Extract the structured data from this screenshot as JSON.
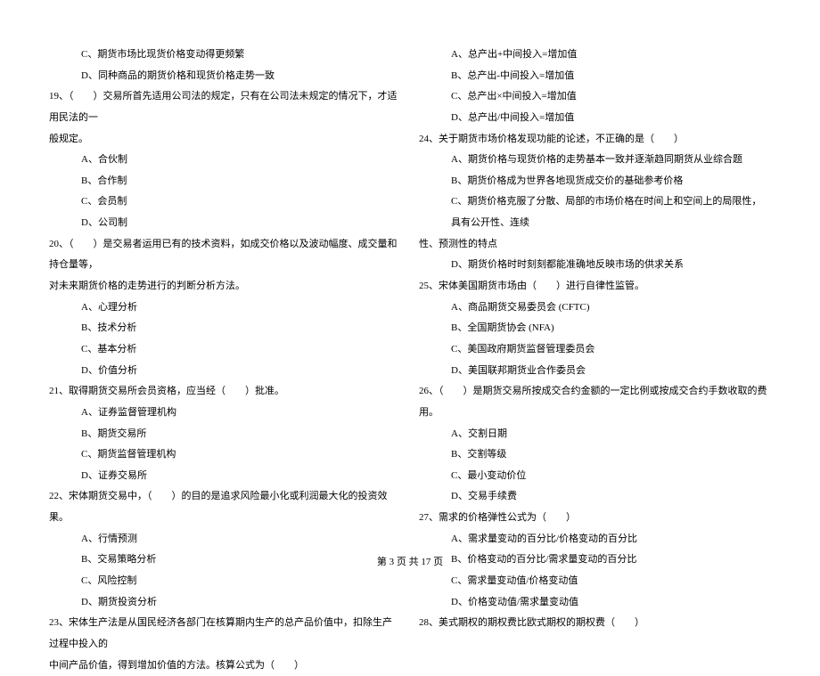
{
  "left_column": [
    {
      "type": "option",
      "text": "C、期货市场比现货价格变动得更频繁"
    },
    {
      "type": "option",
      "text": "D、同种商品的期货价格和现货价格走势一致"
    },
    {
      "type": "question",
      "text": "19、（　　）交易所首先适用公司法的规定，只有在公司法未规定的情况下，才适用民法的一"
    },
    {
      "type": "continuation",
      "text": "般规定。"
    },
    {
      "type": "option",
      "text": "A、合伙制"
    },
    {
      "type": "option",
      "text": "B、合作制"
    },
    {
      "type": "option",
      "text": "C、会员制"
    },
    {
      "type": "option",
      "text": "D、公司制"
    },
    {
      "type": "question",
      "text": "20、（　　）是交易者运用已有的技术资料，如成交价格以及波动幅度、成交量和持仓量等，"
    },
    {
      "type": "continuation",
      "text": "对未来期货价格的走势进行的判断分析方法。"
    },
    {
      "type": "option",
      "text": "A、心理分析"
    },
    {
      "type": "option",
      "text": "B、技术分析"
    },
    {
      "type": "option",
      "text": "C、基本分析"
    },
    {
      "type": "option",
      "text": "D、价值分析"
    },
    {
      "type": "question",
      "text": "21、取得期货交易所会员资格，应当经（　　）批准。"
    },
    {
      "type": "option",
      "text": "A、证券监督管理机构"
    },
    {
      "type": "option",
      "text": "B、期货交易所"
    },
    {
      "type": "option",
      "text": "C、期货监督管理机构"
    },
    {
      "type": "option",
      "text": "D、证券交易所"
    },
    {
      "type": "question",
      "text": "22、宋体期货交易中，（　　）的目的是追求风险最小化或利润最大化的投资效果。"
    },
    {
      "type": "option",
      "text": "A、行情预测"
    },
    {
      "type": "option",
      "text": "B、交易策略分析"
    },
    {
      "type": "option",
      "text": "C、风险控制"
    },
    {
      "type": "option",
      "text": "D、期货投资分析"
    },
    {
      "type": "question",
      "text": "23、宋体生产法是从国民经济各部门在核算期内生产的总产品价值中，扣除生产过程中投入的"
    },
    {
      "type": "continuation",
      "text": "中间产品价值，得到增加价值的方法。核算公式为（　　）"
    }
  ],
  "right_column": [
    {
      "type": "option",
      "text": "A、总产出+中间投入=增加值"
    },
    {
      "type": "option",
      "text": "B、总产出-中间投入=增加值"
    },
    {
      "type": "option",
      "text": "C、总产出×中间投入=增加值"
    },
    {
      "type": "option",
      "text": "D、总产出/中间投入=增加值"
    },
    {
      "type": "question",
      "text": "24、关于期货市场价格发现功能的论述，不正确的是（　　）"
    },
    {
      "type": "option",
      "text": "A、期货价格与现货价格的走势基本一致并逐渐趋同期货从业综合题"
    },
    {
      "type": "option",
      "text": "B、期货价格成为世界各地现货成交价的基础参考价格"
    },
    {
      "type": "option",
      "text": "C、期货价格克服了分散、局部的市场价格在时间上和空间上的局限性，具有公开性、连续"
    },
    {
      "type": "continuation",
      "text": "性、预测性的特点"
    },
    {
      "type": "option",
      "text": "D、期货价格时时刻刻都能准确地反映市场的供求关系"
    },
    {
      "type": "question",
      "text": "25、宋体美国期货市场由（　　）进行自律性监管。"
    },
    {
      "type": "option",
      "text": "A、商品期货交易委员会 (CFTC)"
    },
    {
      "type": "option",
      "text": "B、全国期货协会 (NFA)"
    },
    {
      "type": "option",
      "text": "C、美国政府期货监督管理委员会"
    },
    {
      "type": "option",
      "text": "D、美国联邦期货业合作委员会"
    },
    {
      "type": "question",
      "text": "26、（　　）是期货交易所按成交合约金额的一定比例或按成交合约手数收取的费用。"
    },
    {
      "type": "option",
      "text": "A、交割日期"
    },
    {
      "type": "option",
      "text": "B、交割等级"
    },
    {
      "type": "option",
      "text": "C、最小变动价位"
    },
    {
      "type": "option",
      "text": "D、交易手续费"
    },
    {
      "type": "question",
      "text": "27、需求的价格弹性公式为（　　）"
    },
    {
      "type": "option",
      "text": "A、需求量变动的百分比/价格变动的百分比"
    },
    {
      "type": "option",
      "text": "B、价格变动的百分比/需求量变动的百分比"
    },
    {
      "type": "option",
      "text": "C、需求量变动值/价格变动值"
    },
    {
      "type": "option",
      "text": "D、价格变动值/需求量变动值"
    },
    {
      "type": "question",
      "text": "28、美式期权的期权费比欧式期权的期权费（　　）"
    }
  ],
  "footer": "第 3 页 共 17 页"
}
